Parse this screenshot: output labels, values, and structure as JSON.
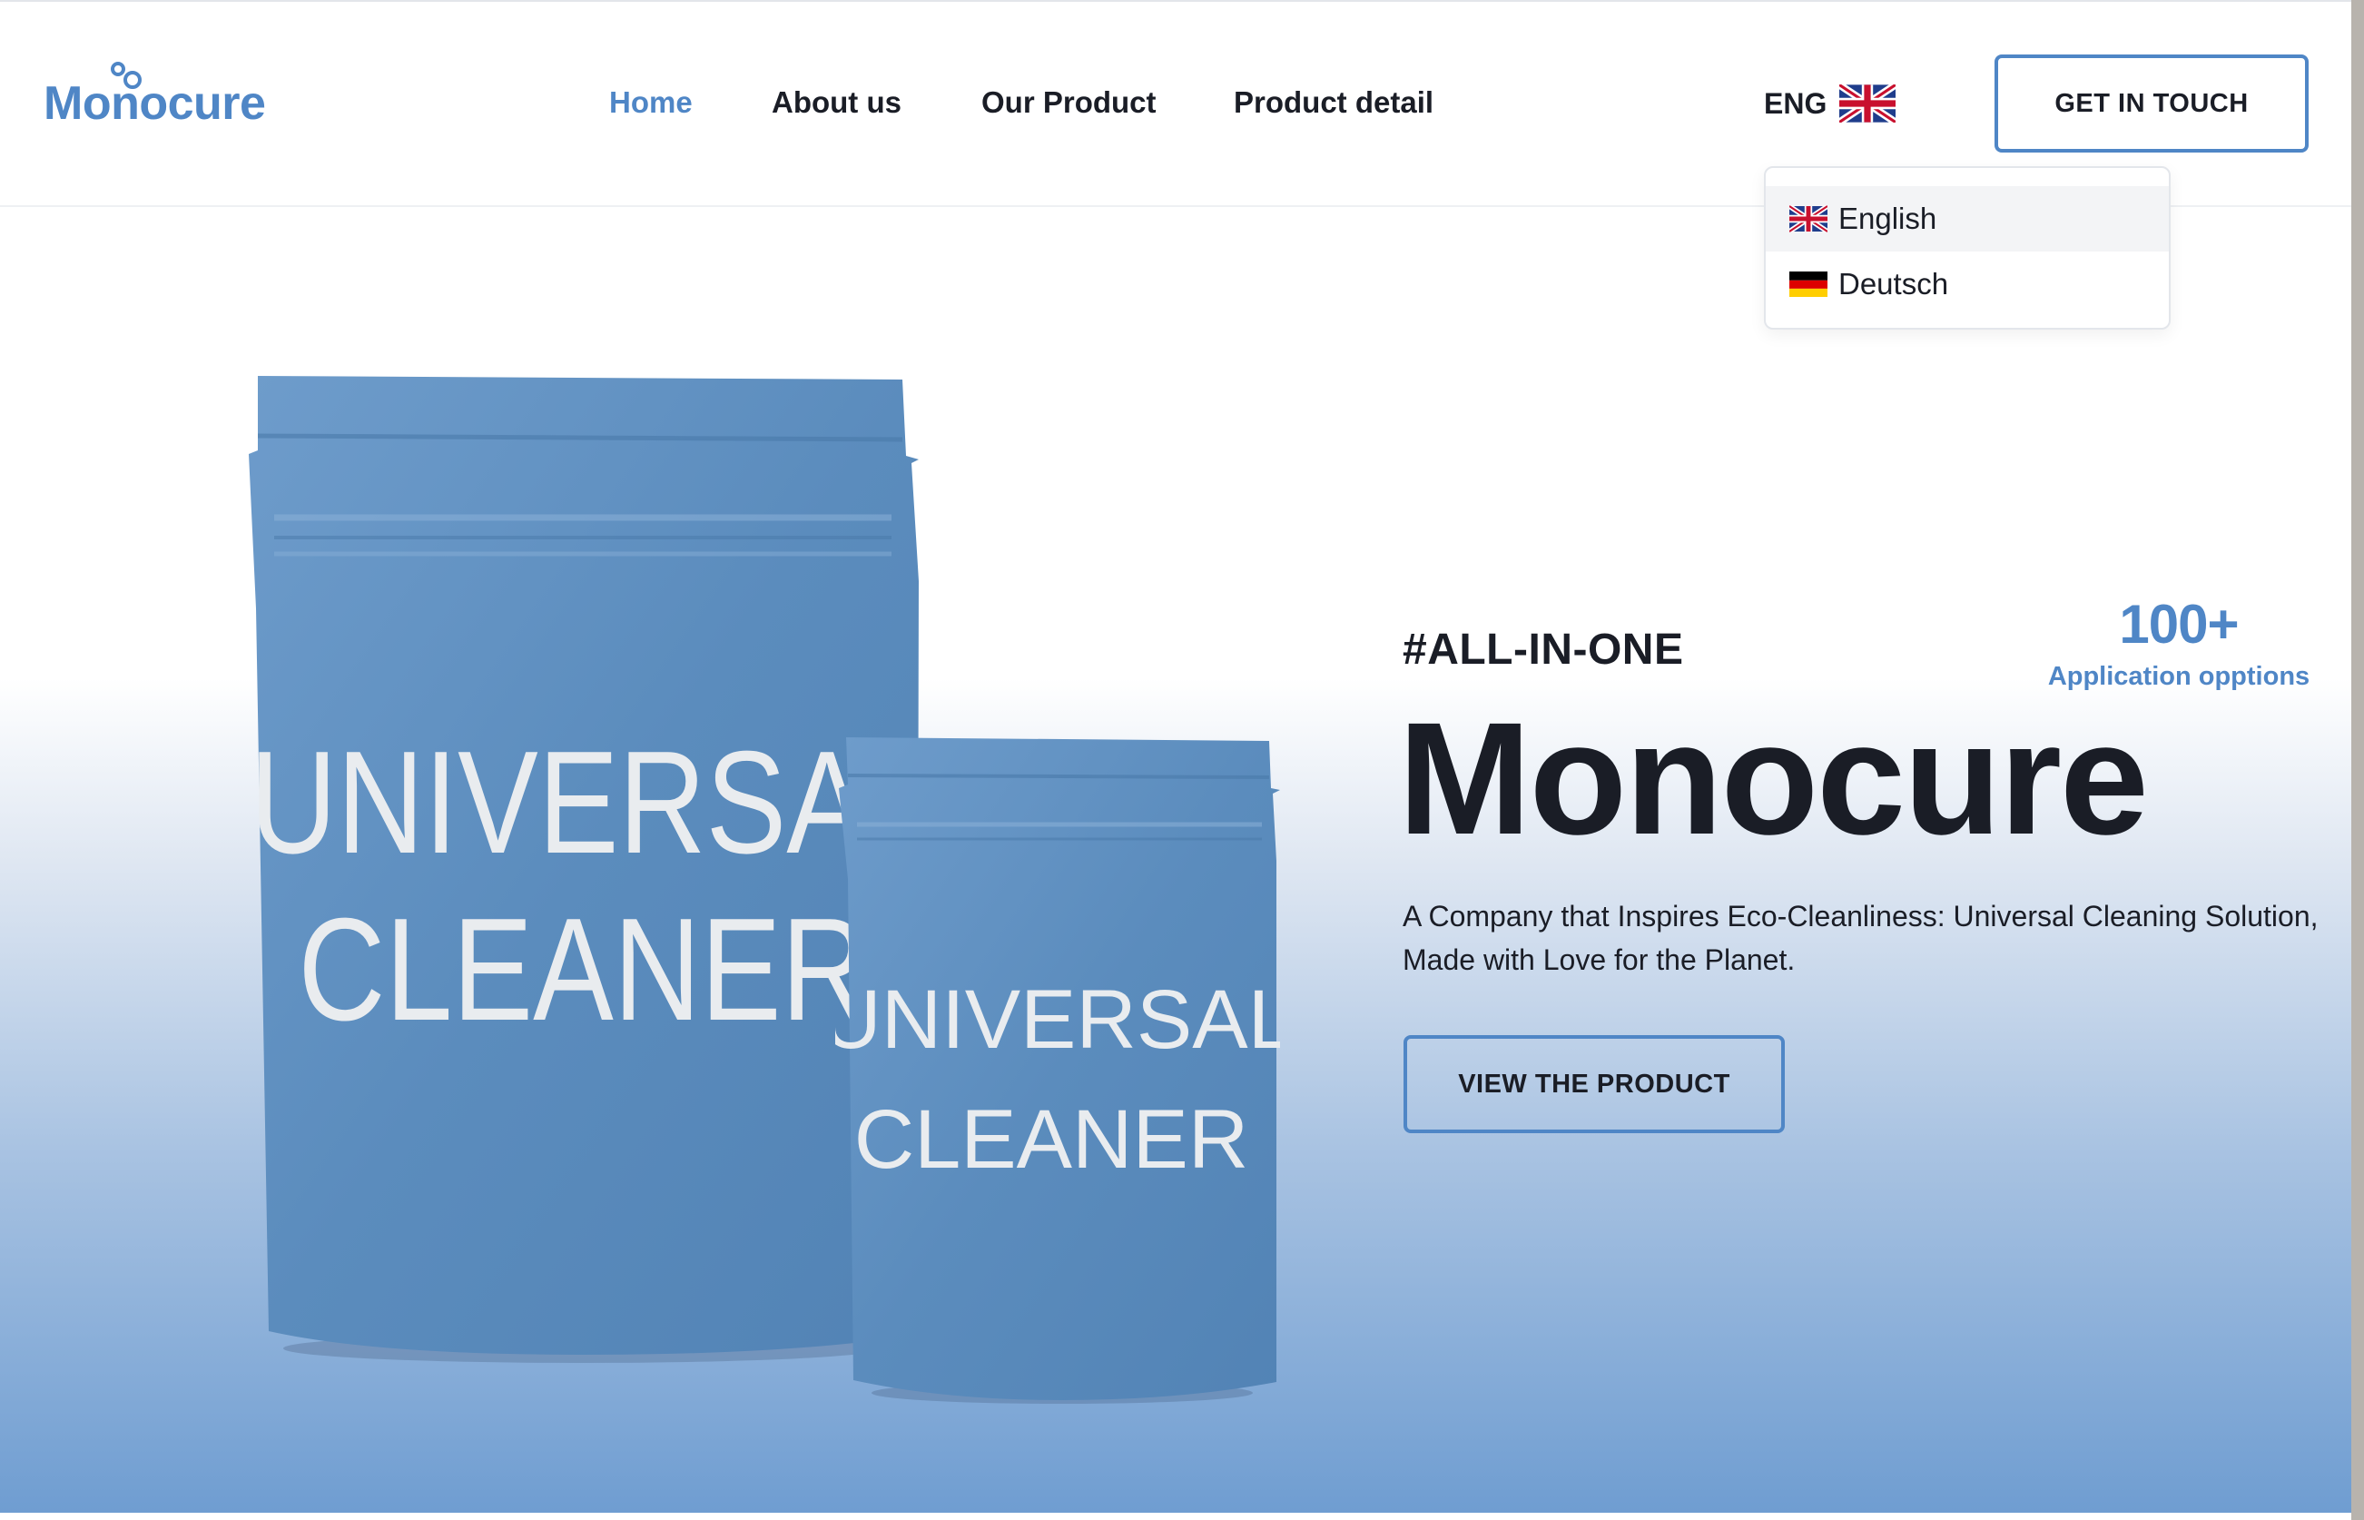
{
  "brand": {
    "name": "Monocure",
    "color": "#4f86c6"
  },
  "nav": {
    "items": [
      {
        "label": "Home",
        "active": true
      },
      {
        "label": "About us",
        "active": false
      },
      {
        "label": "Our Product",
        "active": false
      },
      {
        "label": "Product detail",
        "active": false
      }
    ]
  },
  "language": {
    "current": "ENG",
    "current_flag": "uk-flag-icon",
    "options": [
      {
        "label": "English",
        "flag": "uk-flag-icon",
        "selected": true
      },
      {
        "label": "Deutsch",
        "flag": "germany-flag-icon",
        "selected": false
      }
    ]
  },
  "header": {
    "cta_label": "GET IN TOUCH"
  },
  "hero": {
    "hashtag": "#ALL-IN-ONE",
    "title": "Monocure",
    "description": "A Company that Inspires Eco-Cleanliness: Universal Cleaning Solution, Made with Love for the Planet.",
    "button_label": "VIEW THE PRODUCT",
    "stat": {
      "value": "100+",
      "label": "Application opptions"
    },
    "product_image": {
      "large_label_line1": "UNIVERSAL",
      "large_label_line2": "CLEANER",
      "small_label_line1": "UNIVERSAL",
      "small_label_line2": "CLEANER"
    }
  },
  "colors": {
    "accent": "#4f86c6",
    "text": "#1a1d26",
    "pouch": "#5f92c4"
  }
}
